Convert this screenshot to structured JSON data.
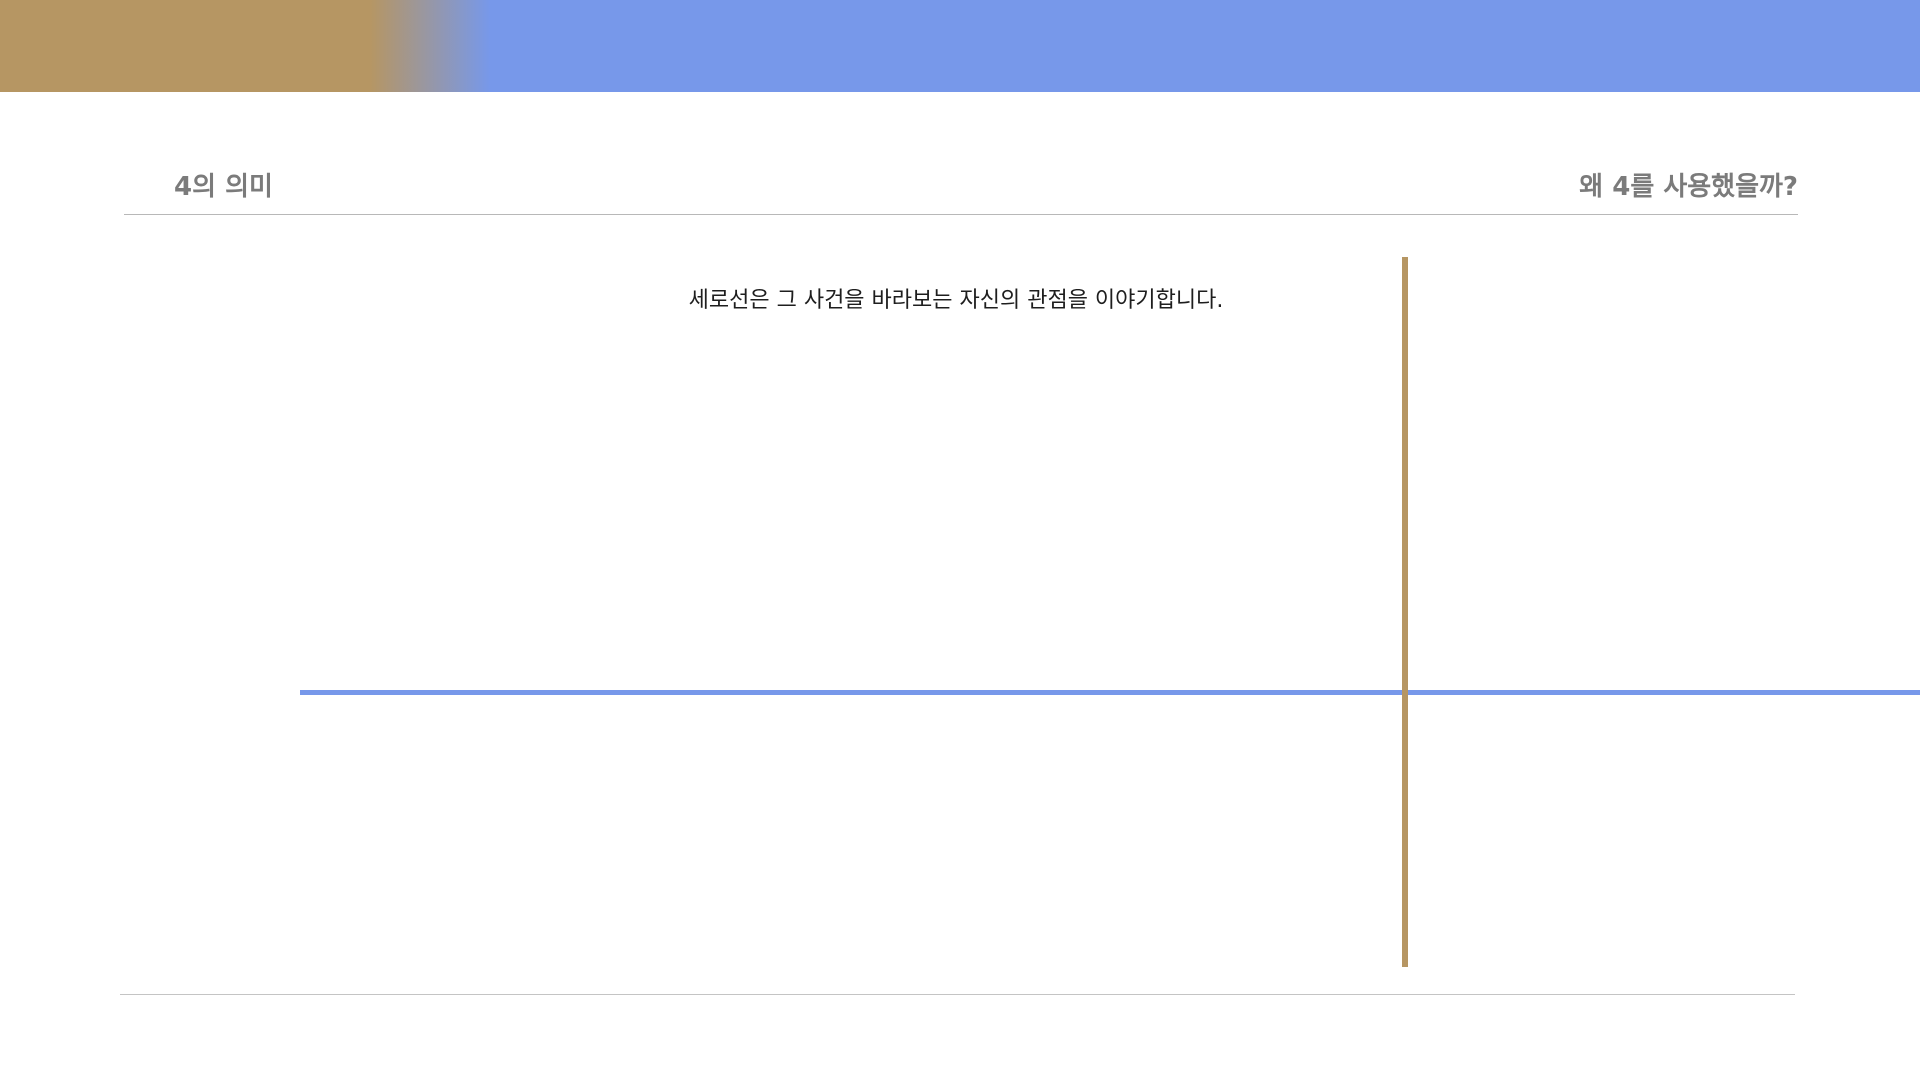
{
  "header": {
    "title": "4의 의미",
    "question": "왜 4를 사용했을까?"
  },
  "main": {
    "text": "세로선은 그 사건을 바라보는 자신의 관점을 이야기합니다."
  },
  "colors": {
    "accent_gold": "#b69663",
    "accent_blue": "#7798ea",
    "header_text": "#7b7b7b",
    "divider": "#b8b8b8"
  }
}
